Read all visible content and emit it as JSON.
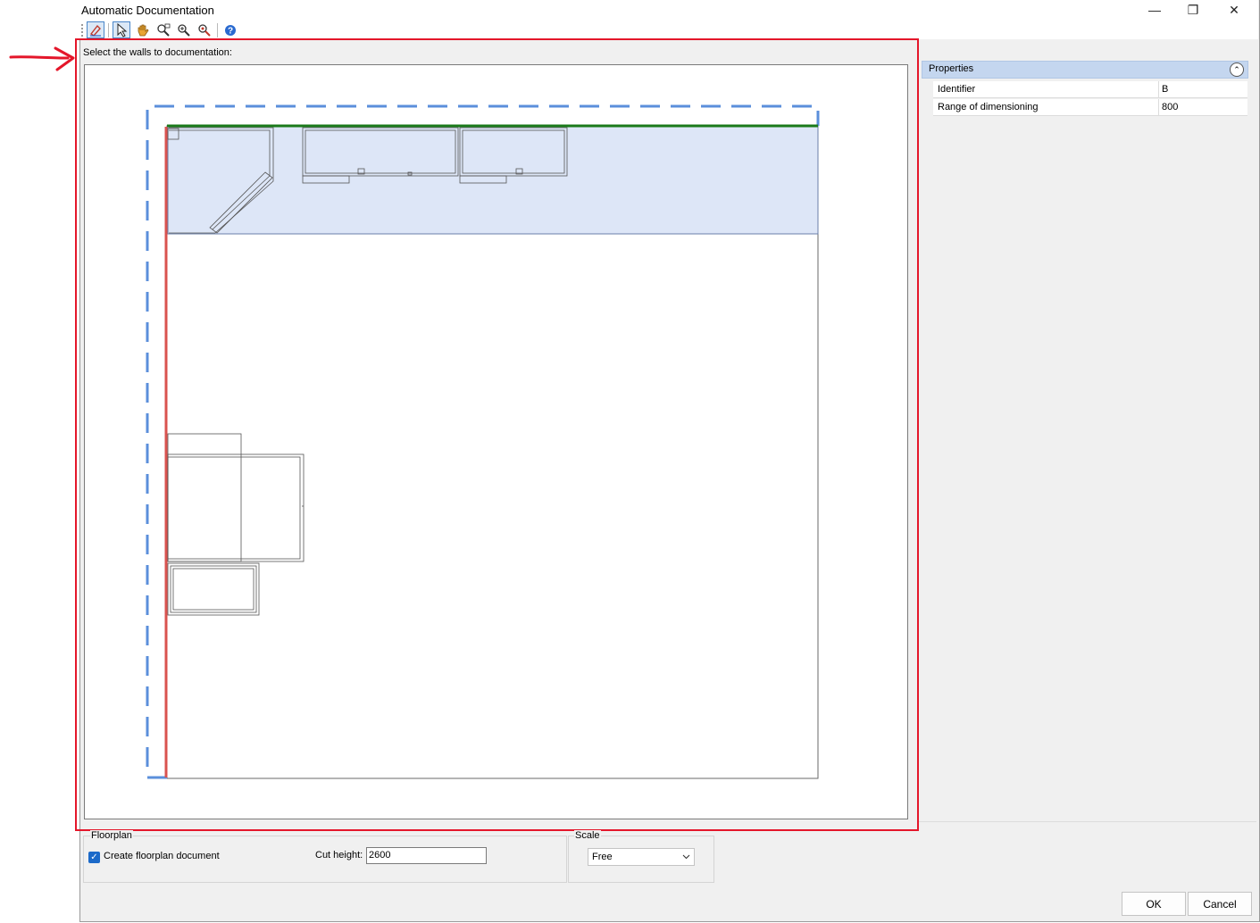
{
  "window": {
    "title": "Automatic Documentation",
    "controls": {
      "minimize": "—",
      "restore": "❐",
      "close": "✕"
    }
  },
  "toolbar": {
    "tools": [
      {
        "name": "select-walls-icon",
        "active": true
      },
      {
        "name": "pointer-icon",
        "active": true
      },
      {
        "name": "pan-hand-icon",
        "active": false
      },
      {
        "name": "zoom-window-icon",
        "active": false
      },
      {
        "name": "zoom-in-icon",
        "active": false
      },
      {
        "name": "zoom-extents-icon",
        "active": false
      },
      {
        "name": "help-icon",
        "active": false
      }
    ]
  },
  "main": {
    "prompt": "Select the walls to documentation:"
  },
  "properties": {
    "header": "Properties",
    "rows": [
      {
        "label": "Identifier",
        "value": "B"
      },
      {
        "label": "Range of dimensioning",
        "value": "800"
      }
    ]
  },
  "floorplan": {
    "group_label": "Floorplan",
    "checkbox_label": "Create floorplan document",
    "checkbox_checked": true,
    "cut_height_label": "Cut height:",
    "cut_height_value": "2600"
  },
  "scale": {
    "group_label": "Scale",
    "selected": "Free"
  },
  "buttons": {
    "ok": "OK",
    "cancel": "Cancel"
  },
  "colors": {
    "selection_outline": "#5b8fdb",
    "selected_wall": "#1a7a1a",
    "active_wall": "#d9534f",
    "highlight_fill": "#dde6f7",
    "annotation_red": "#e4162a"
  }
}
